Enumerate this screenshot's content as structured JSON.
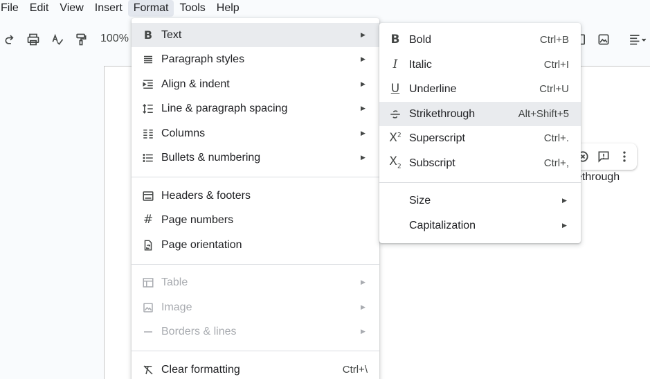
{
  "menubar": {
    "items": [
      {
        "label": "File"
      },
      {
        "label": "Edit"
      },
      {
        "label": "View"
      },
      {
        "label": "Insert"
      },
      {
        "label": "Format",
        "active": true
      },
      {
        "label": "Tools"
      },
      {
        "label": "Help"
      }
    ]
  },
  "toolbar": {
    "zoom": "100%",
    "icons": [
      "redo-icon",
      "print-icon",
      "spellcheck-icon",
      "paint-format-icon",
      "image-icon",
      "align-left-icon"
    ]
  },
  "document": {
    "visible_text": "ethrough"
  },
  "format_menu": {
    "items": [
      {
        "label": "Text",
        "icon": "bold-icon",
        "submenu": true,
        "highlighted": true
      },
      {
        "label": "Paragraph styles",
        "icon": "paragraph-styles-icon",
        "submenu": true
      },
      {
        "label": "Align & indent",
        "icon": "align-indent-icon",
        "submenu": true
      },
      {
        "label": "Line & paragraph spacing",
        "icon": "line-spacing-icon",
        "submenu": true
      },
      {
        "label": "Columns",
        "icon": "columns-icon",
        "submenu": true
      },
      {
        "label": "Bullets & numbering",
        "icon": "bullets-icon",
        "submenu": true
      },
      {
        "label": "Headers & footers",
        "icon": "headers-footers-icon"
      },
      {
        "label": "Page numbers",
        "icon": "hash-icon"
      },
      {
        "label": "Page orientation",
        "icon": "page-orientation-icon"
      },
      {
        "label": "Table",
        "icon": "table-icon",
        "submenu": true,
        "disabled": true
      },
      {
        "label": "Image",
        "icon": "image-icon",
        "submenu": true,
        "disabled": true
      },
      {
        "label": "Borders & lines",
        "icon": "borders-icon",
        "submenu": true,
        "disabled": true
      },
      {
        "label": "Clear formatting",
        "icon": "clear-formatting-icon",
        "shortcut": "Ctrl+\\"
      }
    ]
  },
  "text_menu": {
    "items": [
      {
        "label": "Bold",
        "icon": "bold-icon",
        "shortcut": "Ctrl+B"
      },
      {
        "label": "Italic",
        "icon": "italic-icon",
        "shortcut": "Ctrl+I"
      },
      {
        "label": "Underline",
        "icon": "underline-icon",
        "shortcut": "Ctrl+U"
      },
      {
        "label": "Strikethrough",
        "icon": "strikethrough-icon",
        "shortcut": "Alt+Shift+5",
        "highlighted": true
      },
      {
        "label": "Superscript",
        "icon": "superscript-icon",
        "shortcut": "Ctrl+."
      },
      {
        "label": "Subscript",
        "icon": "subscript-icon",
        "shortcut": "Ctrl+,"
      },
      {
        "label": "Size",
        "submenu": true
      },
      {
        "label": "Capitalization",
        "submenu": true
      }
    ]
  },
  "colors": {
    "background": "#f9fbfd",
    "menu_highlight": "#e9ebee",
    "active_menubar": "#e3e7ee",
    "disabled_text": "#a8abb0"
  }
}
